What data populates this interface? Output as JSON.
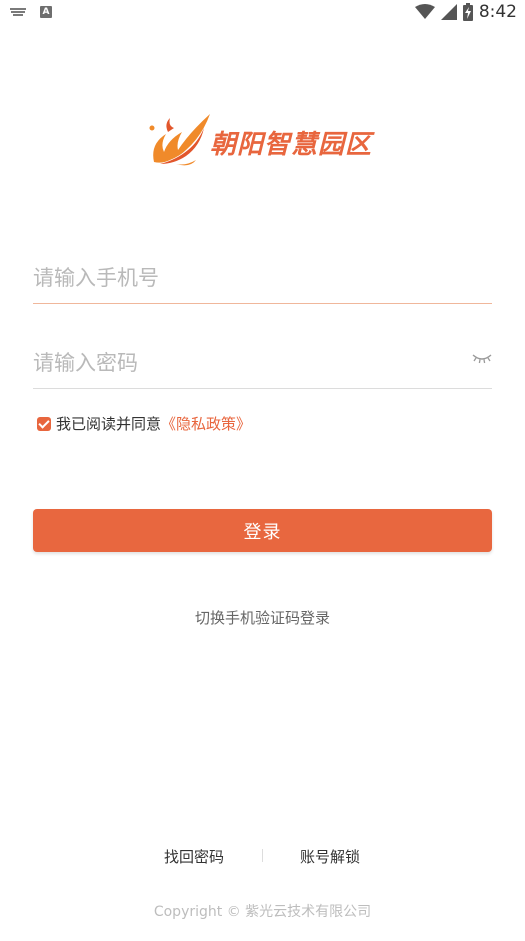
{
  "status_bar": {
    "time": "8:42",
    "icons": [
      "keyboard-icon",
      "a-notification-icon",
      "wifi-icon",
      "signal-icon",
      "battery-icon"
    ]
  },
  "logo": {
    "text": "朝阳智慧园区",
    "icon": "phoenix-logo-icon"
  },
  "form": {
    "phone_placeholder": "请输入手机号",
    "phone_value": "",
    "password_placeholder": "请输入密码",
    "password_value": "",
    "password_toggle_icon": "eye-closed-icon"
  },
  "agreement": {
    "checked": true,
    "text": "我已阅读并同意",
    "policy_link": "《隐私政策》"
  },
  "login_button": {
    "label": "登录"
  },
  "switch_login": {
    "label": "切换手机验证码登录"
  },
  "footer": {
    "find_password": "找回密码",
    "unlock_account": "账号解锁",
    "copyright": "Copyright © 紫光云技术有限公司"
  },
  "colors": {
    "accent": "#e8673f",
    "underline_active": "#f0b79b",
    "underline": "#dcdcdc",
    "placeholder": "#b9b9b9"
  }
}
